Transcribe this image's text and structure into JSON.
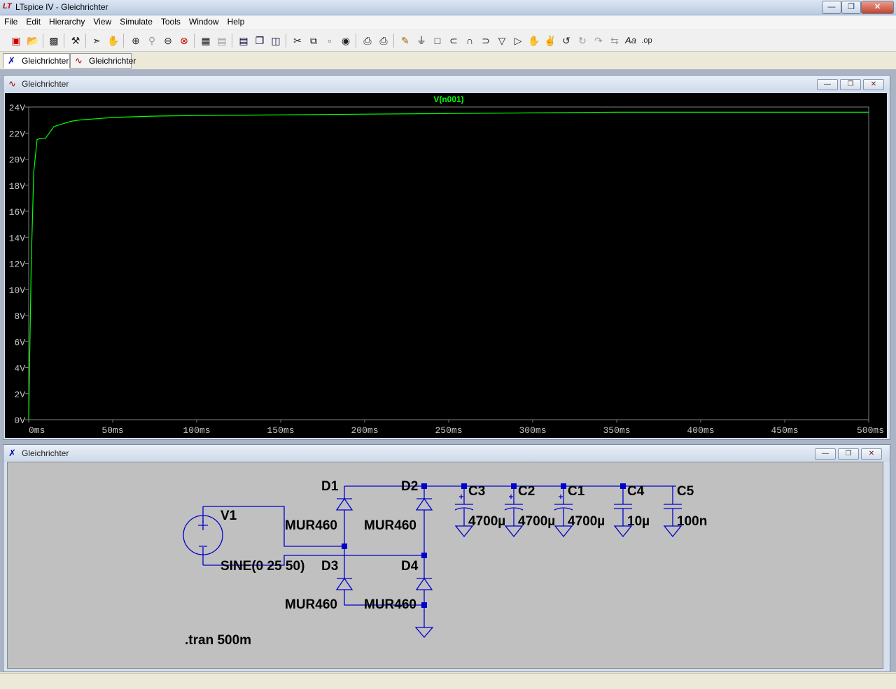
{
  "window": {
    "title": "LTspice IV - Gleichrichter",
    "app_icon": "LT"
  },
  "menu": [
    "File",
    "Edit",
    "Hierarchy",
    "View",
    "Simulate",
    "Tools",
    "Window",
    "Help"
  ],
  "toolbar_icons": [
    "new-schematic-icon",
    "open-icon",
    "save-icon",
    "control-panel-icon",
    "run-icon",
    "halt-icon",
    "zoom-in-icon",
    "zoom-full-icon",
    "zoom-out-icon",
    "zoom-cancel-icon",
    "autorange-icon",
    "delete-plot-icon",
    "tile-horizontal-icon",
    "cascade-icon",
    "tile-vertical-icon",
    "cut-icon",
    "copy-icon",
    "paste-icon",
    "find-icon",
    "print-setup-icon",
    "print-icon",
    "draw-wire-icon",
    "ground-icon",
    "label-net-icon",
    "resistor-icon",
    "capacitor-icon",
    "inductor-icon",
    "diode-icon",
    "component-icon",
    "move-icon",
    "drag-icon",
    "undo-icon",
    "redo-icon",
    "rotate-icon",
    "mirror-icon",
    "text-icon",
    "spice-directive-icon"
  ],
  "tabs": [
    {
      "label": "Gleichrichter",
      "icon": "schematic-icon"
    },
    {
      "label": "Gleichrichter",
      "icon": "waveform-icon"
    }
  ],
  "plot_window": {
    "title": "Gleichrichter",
    "trace_label": "V(n001)",
    "trace_color": "#00ff00"
  },
  "chart_data": {
    "type": "line",
    "title": "",
    "series": [
      {
        "name": "V(n001)",
        "x": [
          0,
          1.5,
          3,
          5,
          7,
          10,
          15,
          20,
          25,
          30,
          40,
          50,
          75,
          100,
          150,
          200,
          250,
          300,
          350,
          400,
          450,
          500
        ],
        "y": [
          0,
          12,
          19,
          21.5,
          21.6,
          21.6,
          22.5,
          22.7,
          22.9,
          23.0,
          23.1,
          23.2,
          23.3,
          23.35,
          23.4,
          23.45,
          23.5,
          23.55,
          23.6,
          23.6,
          23.6,
          23.6
        ]
      }
    ],
    "xlim": [
      0,
      500
    ],
    "ylim": [
      0,
      24
    ],
    "x_ticks": [
      "0ms",
      "50ms",
      "100ms",
      "150ms",
      "200ms",
      "250ms",
      "300ms",
      "350ms",
      "400ms",
      "450ms",
      "500ms"
    ],
    "y_ticks": [
      "0V",
      "2V",
      "4V",
      "6V",
      "8V",
      "10V",
      "12V",
      "14V",
      "16V",
      "18V",
      "20V",
      "22V",
      "24V"
    ],
    "grid": false
  },
  "schematic_window": {
    "title": "Gleichrichter",
    "source": {
      "name": "V1",
      "value": "SINE(0 25 50)"
    },
    "diodes": [
      {
        "name": "D1",
        "model": "MUR460"
      },
      {
        "name": "D2",
        "model": "MUR460"
      },
      {
        "name": "D3",
        "model": "MUR460"
      },
      {
        "name": "D4",
        "model": "MUR460"
      }
    ],
    "capacitors": [
      {
        "name": "C3",
        "value": "4700µ"
      },
      {
        "name": "C2",
        "value": "4700µ"
      },
      {
        "name": "C1",
        "value": "4700µ"
      },
      {
        "name": "C4",
        "value": "10µ"
      },
      {
        "name": "C5",
        "value": "100n"
      }
    ],
    "directive": ".tran 500m",
    "wire_color": "#0000cc"
  },
  "status_text": ""
}
